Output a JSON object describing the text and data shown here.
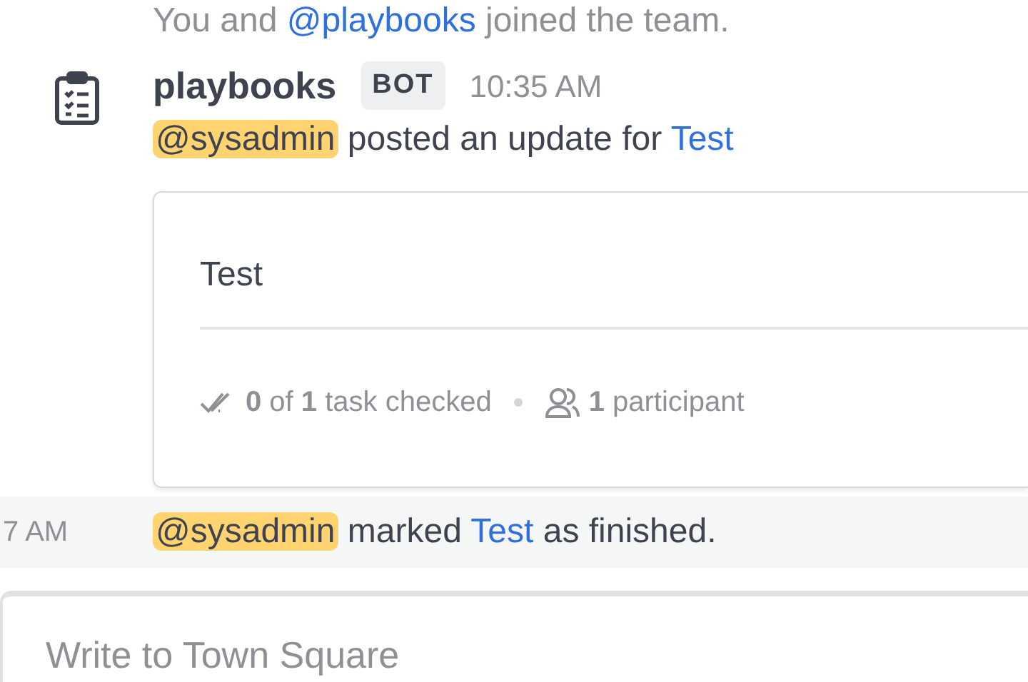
{
  "system_message": {
    "parts": [
      {
        "kind": "plain",
        "text": "You and "
      },
      {
        "kind": "link",
        "text": "@playbooks"
      },
      {
        "kind": "plain",
        "text": " joined the team."
      }
    ]
  },
  "post": {
    "author": "playbooks",
    "badge": "BOT",
    "time": "10:35 AM",
    "message_parts": [
      {
        "kind": "mention",
        "text": "@sysadmin"
      },
      {
        "kind": "plain",
        "text": " posted an update for "
      },
      {
        "kind": "link",
        "text": "Test"
      }
    ],
    "card": {
      "title": "Test",
      "footer": [
        {
          "kind": "tasks",
          "text": "**0** of **1** task checked"
        },
        {
          "kind": "participants",
          "text": "**1** participant"
        }
      ]
    }
  },
  "followup": {
    "time": "7 AM",
    "parts": [
      {
        "kind": "mention",
        "text": "@sysadmin"
      },
      {
        "kind": "plain",
        "text": " marked "
      },
      {
        "kind": "link",
        "text": "Test"
      },
      {
        "kind": "plain",
        "text": " as finished."
      }
    ]
  },
  "composer": {
    "placeholder": "Write to Town Square"
  }
}
